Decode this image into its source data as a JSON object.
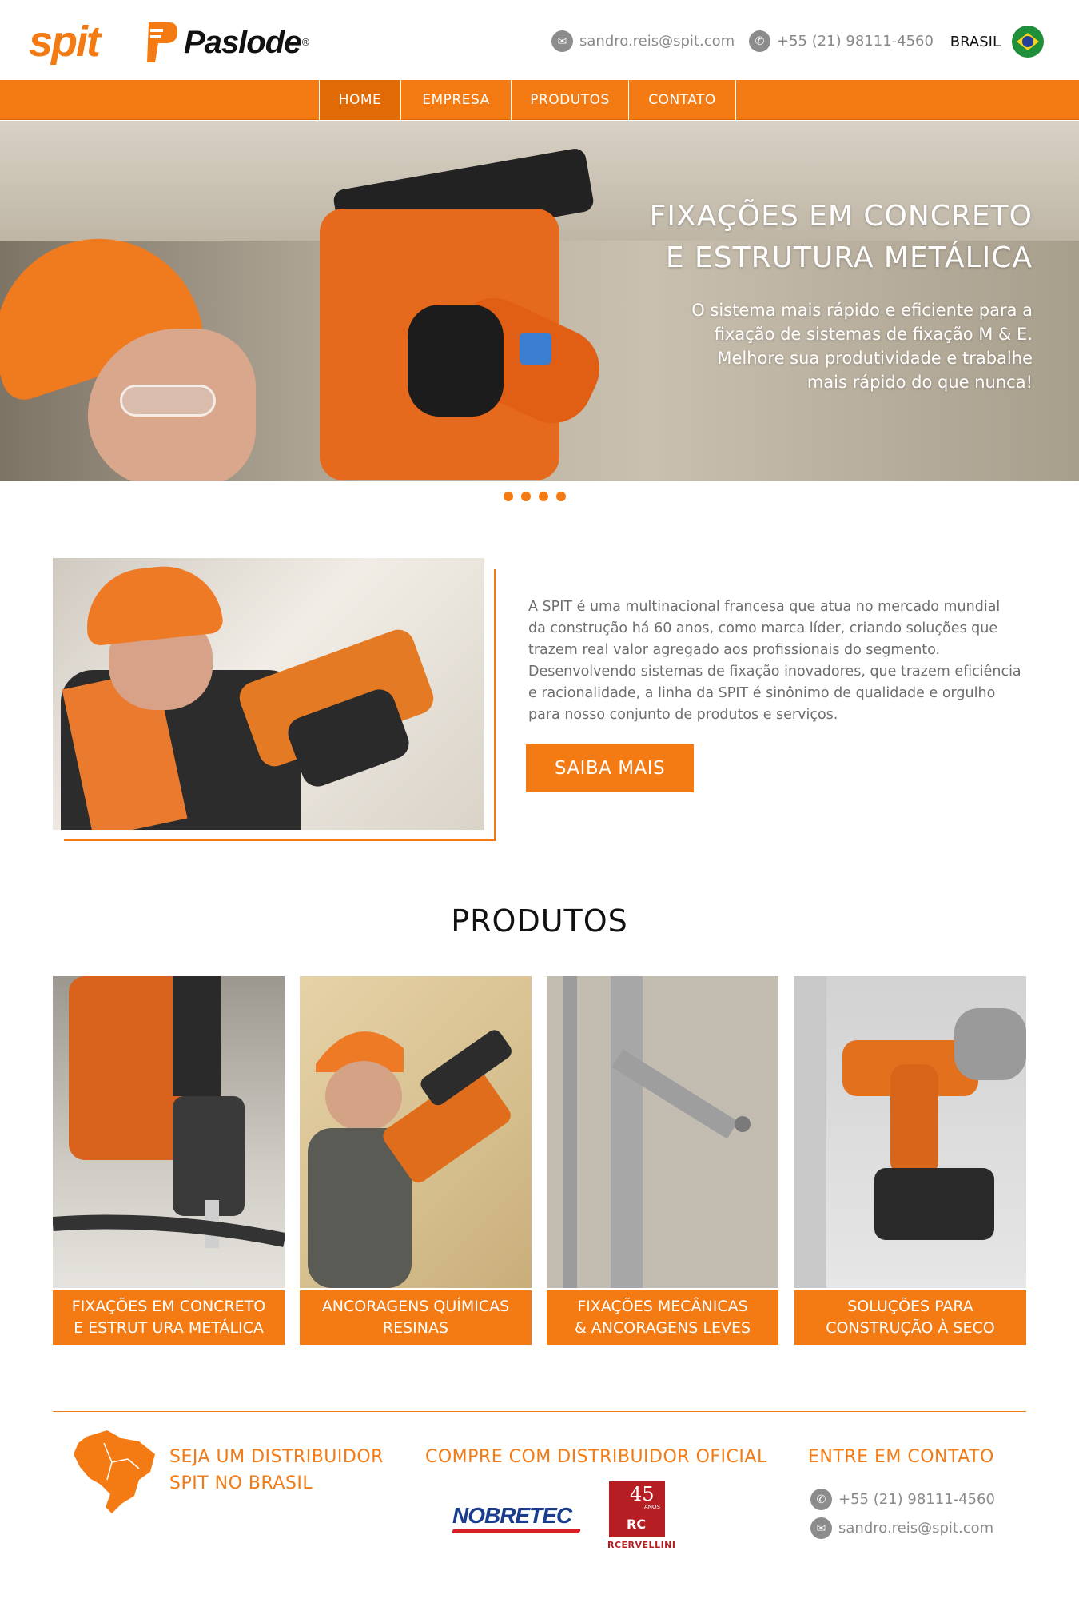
{
  "brand": {
    "spit_logo": "spit",
    "paslode_logo": "Paslode",
    "paslode_reg": "®"
  },
  "header": {
    "email": "sandro.reis@spit.com",
    "phone": "+55 (21) 98111-4560",
    "country": "BRASIL",
    "mail_icon": "mail-icon",
    "phone_icon": "phone-icon",
    "flag_icon": "brazil-flag-icon"
  },
  "nav": {
    "items": [
      {
        "label": "HOME",
        "active": true
      },
      {
        "label": "EMPRESA",
        "active": false
      },
      {
        "label": "PRODUTOS",
        "active": false
      },
      {
        "label": "CONTATO",
        "active": false
      }
    ]
  },
  "hero": {
    "title_line1": "FIXAÇÕES EM CONCRETO",
    "title_line2": "E ESTRUTURA METÁLICA",
    "sub_line1": "O sistema mais rápido e eficiente para a",
    "sub_line2": "fixação de sistemas de fixação M & E.",
    "sub_line3": "Melhore sua produtividade e trabalhe",
    "sub_line4": "mais rápido do que nunca!",
    "slide_count": 4
  },
  "about": {
    "line1": "A SPIT é uma multinacional francesa que atua no mercado mundial",
    "line2": "da construção há 60 anos, como marca líder, criando soluções que",
    "line3": "trazem real valor agregado aos profissionais do segmento.",
    "line4": "Desenvolvendo sistemas de fixação inovadores, que trazem eficiência",
    "line5": "e racionalidade, a linha da SPIT é sinônimo de qualidade e orgulho",
    "line6": "para nosso conjunto de produtos e serviços.",
    "button": "SAIBA MAIS"
  },
  "products": {
    "title": "PRODUTOS",
    "items": [
      {
        "line1": "FIXAÇÕES EM CONCRETO",
        "line2": "E ESTRUT URA METÁLICA"
      },
      {
        "line1": "ANCORAGENS QUÍMICAS",
        "line2": "RESINAS"
      },
      {
        "line1": "FIXAÇÕES MECÂNICAS",
        "line2": "& ANCORAGENS LEVES"
      },
      {
        "line1": "SOLUÇÕES PARA",
        "line2": "CONSTRUÇÃO À SECO"
      }
    ]
  },
  "footer": {
    "distrib_line1": "SEJA UM DISTRIBUIDOR",
    "distrib_line2": "SPIT NO BRASIL",
    "buy_title": "COMPRE COM DISTRIBUIDOR OFICIAL",
    "partner1": "NOBRETEC",
    "partner2_num": "45",
    "partner2_anos": "ANOS",
    "partner2_rc": "RC",
    "partner2_name": "RCERVELLINI",
    "contact_title": "ENTRE EM CONTATO",
    "phone": "+55 (21) 98111-4560",
    "email": "sandro.reis@spit.com"
  },
  "colors": {
    "accent": "#f47b13",
    "text_gray": "#6e6e6e",
    "icon_gray": "#8c8c8c"
  }
}
